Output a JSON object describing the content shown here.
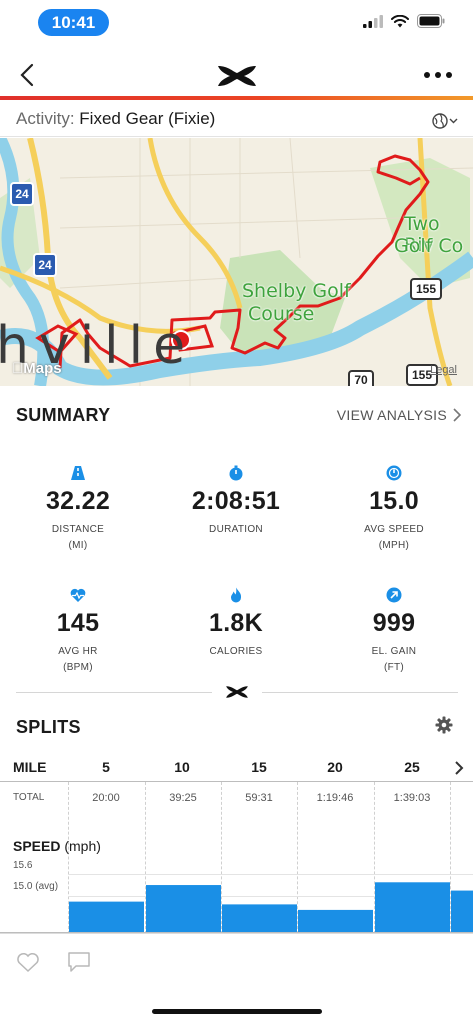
{
  "status": {
    "time": "10:41"
  },
  "activity": {
    "label": "Activity:",
    "value": "Fixed Gear (Fixie)"
  },
  "map": {
    "labels": [
      "Two Riv",
      "Golf Co",
      "Shelby Golf",
      "Course"
    ],
    "city_fragment": "hville",
    "maps_brand": "Maps",
    "legal": "Legal",
    "shields": [
      "24",
      "24",
      "155",
      "155",
      "70"
    ]
  },
  "summary": {
    "title": "SUMMARY",
    "view_analysis": "VIEW ANALYSIS",
    "stats": [
      {
        "value": "32.22",
        "label": "DISTANCE",
        "unit": "(MI)",
        "icon": "road-icon"
      },
      {
        "value": "2:08:51",
        "label": "DURATION",
        "unit": "",
        "icon": "stopwatch-icon"
      },
      {
        "value": "15.0",
        "label": "AVG SPEED",
        "unit": "(MPH)",
        "icon": "speedometer-icon"
      },
      {
        "value": "145",
        "label": "AVG HR",
        "unit": "(BPM)",
        "icon": "heart-rate-icon"
      },
      {
        "value": "1.8K",
        "label": "CALORIES",
        "unit": "",
        "icon": "flame-icon"
      },
      {
        "value": "999",
        "label": "EL. GAIN",
        "unit": "(FT)",
        "icon": "elevation-arrow-icon"
      }
    ]
  },
  "splits": {
    "title": "SPLITS",
    "mile_label": "MILE",
    "columns": [
      "5",
      "10",
      "15",
      "20",
      "25"
    ],
    "total_label": "TOTAL",
    "totals": [
      "20:00",
      "39:25",
      "59:31",
      "1:19:46",
      "1:39:03"
    ],
    "speed_title": "SPEED",
    "speed_unit": "(mph)",
    "y_max_label": "15.6",
    "y_avg_label": "15.0 (avg)"
  },
  "chart_data": {
    "type": "bar",
    "title": "SPEED (mph)",
    "categories": [
      "5",
      "10",
      "15",
      "20",
      "25"
    ],
    "values": [
      14.6,
      15.2,
      14.5,
      14.3,
      15.3
    ],
    "ylim": [
      13.5,
      15.6
    ],
    "reference_lines": [
      {
        "label": "15.0 (avg)",
        "value": 15.0
      }
    ],
    "color": "#1a8fe6"
  },
  "colors": {
    "accent": "#e9412a",
    "bar": "#1a8fe6",
    "route": "#e01b1b",
    "map_green": "#3fa33d",
    "stat_icon": "#1a8fe6"
  }
}
